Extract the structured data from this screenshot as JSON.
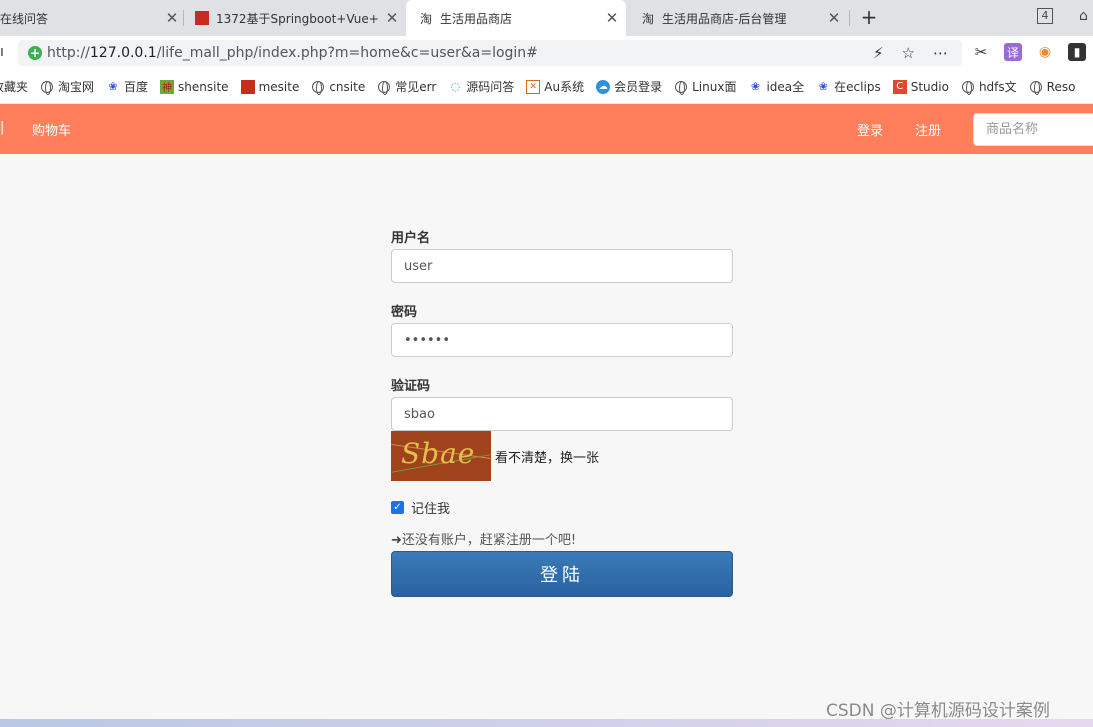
{
  "browser": {
    "tabs": [
      {
        "title": "在线问答",
        "icon": "site-icon",
        "active": false
      },
      {
        "title": "1372基于Springboot+Vue+",
        "icon": "csdn-icon",
        "active": false
      },
      {
        "title": "生活用品商店",
        "icon": "tao-icon",
        "active": true
      },
      {
        "title": "生活用品商店-后台管理",
        "icon": "tao-icon",
        "active": false
      }
    ],
    "tab_favicon_glyph": "淘",
    "new_tab": "+",
    "window_badge": "4",
    "address": {
      "scheme": "http://",
      "host": "127.0.0.1",
      "path": "/life_mall_php/index.php?m=home&c=user&a=login#"
    },
    "bookmarks": [
      {
        "label": "收藏夹",
        "icon": "folder-icon"
      },
      {
        "label": "淘宝网",
        "icon": "globe-icon"
      },
      {
        "label": "百度",
        "icon": "baidu-paw-icon"
      },
      {
        "label": "shensite",
        "icon": "shen-icon"
      },
      {
        "label": "mesite",
        "icon": "mesite-icon"
      },
      {
        "label": "cnsite",
        "icon": "globe-icon"
      },
      {
        "label": "常见err",
        "icon": "globe-icon"
      },
      {
        "label": "源码问答",
        "icon": "swirl-icon"
      },
      {
        "label": "Au系统",
        "icon": "au-icon"
      },
      {
        "label": "会员登录",
        "icon": "cloud-icon"
      },
      {
        "label": "Linux面",
        "icon": "globe-icon"
      },
      {
        "label": "idea全",
        "icon": "baidu-paw-icon"
      },
      {
        "label": "在eclips",
        "icon": "baidu-paw-icon"
      },
      {
        "label": "Studio",
        "icon": "c-icon"
      },
      {
        "label": "hdfs文",
        "icon": "globe-icon"
      },
      {
        "label": "Reso",
        "icon": "globe-icon"
      }
    ]
  },
  "site": {
    "nav": {
      "cart": "购物车",
      "login": "登录",
      "register": "注册",
      "search_placeholder": "商品名称"
    },
    "colors": {
      "header": "#ff7f5c",
      "button": "#2f6aa6"
    }
  },
  "login_form": {
    "username_label": "用户名",
    "username_value": "user",
    "password_label": "密码",
    "password_value": "••••••",
    "captcha_label": "验证码",
    "captcha_value": "sbao",
    "captcha_image_text": "Sbae",
    "captcha_refresh": "看不清楚，换一张",
    "remember_label": "记住我",
    "remember_checked": true,
    "register_prompt": "还没有账户，赶紧注册一个吧!",
    "submit_label": "登陆"
  },
  "watermark": "CSDN @计算机源码设计案例"
}
